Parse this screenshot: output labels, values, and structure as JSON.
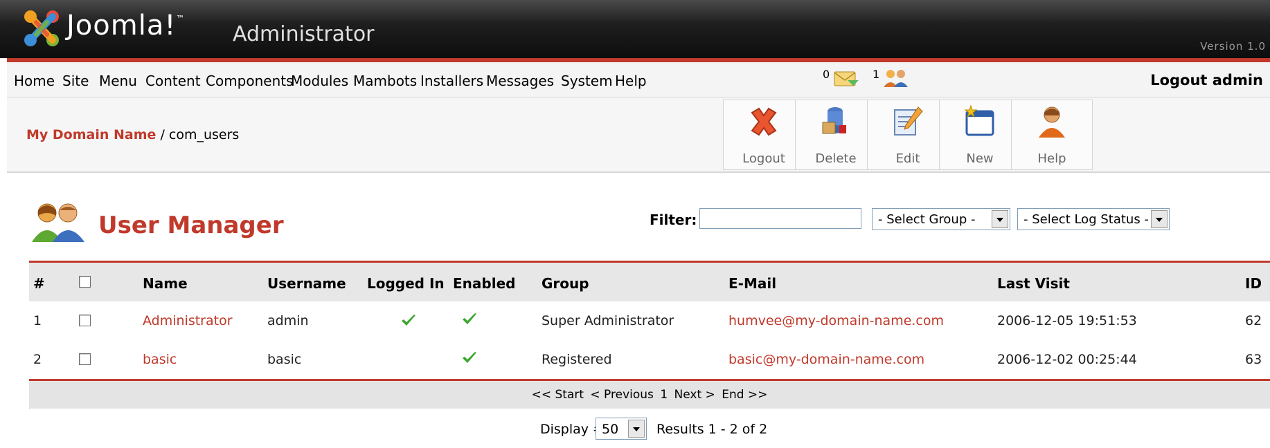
{
  "header": {
    "brand": "Joomla!",
    "brand_tm": "™",
    "subtitle": "Administrator",
    "version": "Version 1.0"
  },
  "menu": {
    "items": [
      "Home",
      "Site",
      "Menu",
      "Content",
      "Components",
      "Modules",
      "Mambots",
      "Installers",
      "Messages",
      "System",
      "Help"
    ],
    "messages_count": "0",
    "users_count": "1",
    "logout_label": "Logout admin"
  },
  "breadcrumb": {
    "site": "My Domain Name",
    "separator": " / ",
    "component": "com_users"
  },
  "toolbar": {
    "buttons": [
      {
        "label": "Logout",
        "icon": "logout-x-icon"
      },
      {
        "label": "Delete",
        "icon": "delete-icon"
      },
      {
        "label": "Edit",
        "icon": "edit-icon"
      },
      {
        "label": "New",
        "icon": "new-icon"
      },
      {
        "label": "Help",
        "icon": "help-icon"
      }
    ]
  },
  "page": {
    "title": "User Manager",
    "filter_label": "Filter:",
    "filter_value": "",
    "group_select": "- Select Group -",
    "log_status_select": "- Select Log Status -"
  },
  "table": {
    "columns": [
      "#",
      "",
      "Name",
      "Username",
      "Logged In",
      "Enabled",
      "Group",
      "E-Mail",
      "Last Visit",
      "ID"
    ],
    "rows": [
      {
        "num": "1",
        "name": "Administrator",
        "username": "admin",
        "logged_in": true,
        "enabled": true,
        "group": "Super Administrator",
        "email": "humvee@my-domain-name.com",
        "last_visit": "2006-12-05 19:51:53",
        "id": "62"
      },
      {
        "num": "2",
        "name": "basic",
        "username": "basic",
        "logged_in": false,
        "enabled": true,
        "group": "Registered",
        "email": "basic@my-domain-name.com",
        "last_visit": "2006-12-02 00:25:44",
        "id": "63"
      }
    ]
  },
  "pagination": {
    "start": "<< Start",
    "previous": "< Previous",
    "page": "1",
    "next": "Next >",
    "end": "End >>",
    "display_label": "Display #",
    "display_value": "50",
    "results": "Results 1 - 2 of 2"
  },
  "colors": {
    "accent": "#c0392b",
    "check": "#3aa52e"
  }
}
